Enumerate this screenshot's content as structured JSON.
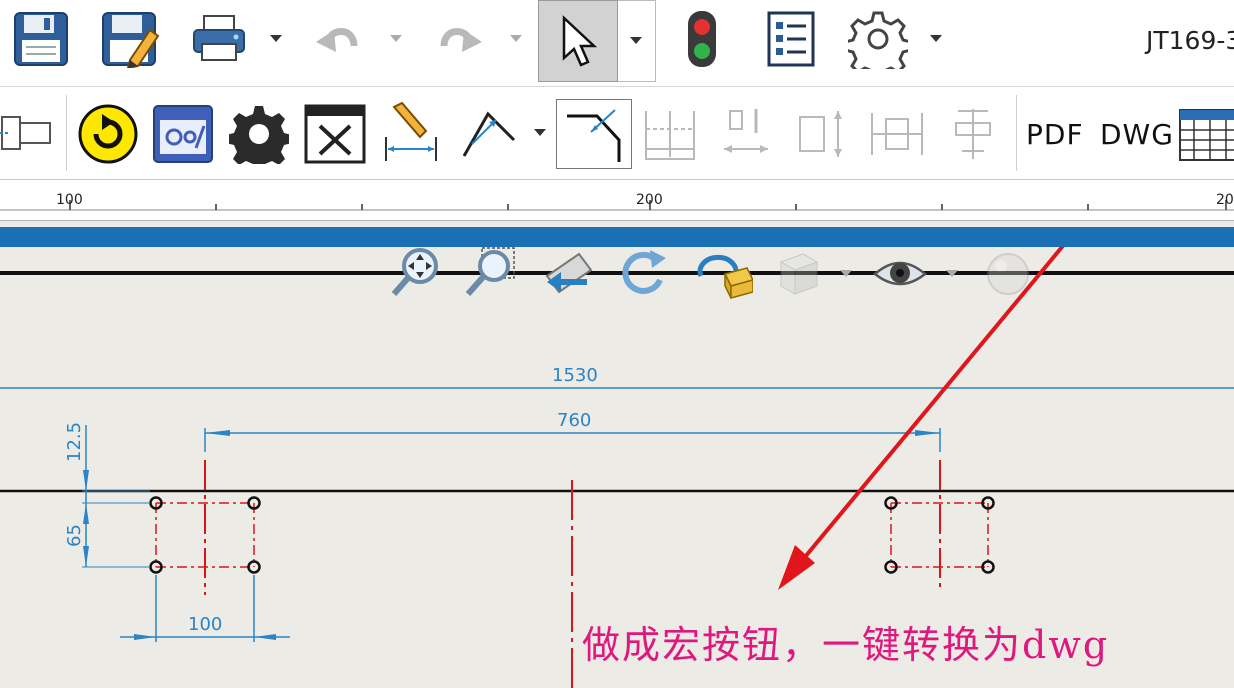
{
  "toolbar": {
    "save_icon": "save-icon",
    "save_as_icon": "save-as-icon",
    "print_icon": "printer-icon",
    "undo_icon": "undo-icon",
    "redo_icon": "redo-icon",
    "select_icon": "cursor-arrow-icon",
    "rebuild_icon": "traffic-light-icon",
    "options_list_icon": "file-properties-icon",
    "settings_icon": "gear-icon"
  },
  "document": {
    "title": "JT169-3"
  },
  "command_bar": {
    "pdf_label": "PDF",
    "dwg_label": "DWG"
  },
  "ruler": {
    "labels": [
      "100",
      "200",
      "20"
    ]
  },
  "drawing": {
    "dim_overall": "1530",
    "dim_span": "760",
    "dim_vertical_top": "12.5",
    "dim_vertical_mid": "65",
    "dim_bottom": "100"
  },
  "annotation": {
    "text": "做成宏按钮，一键转换为dwg"
  },
  "colors": {
    "blue_band": "#1a6fb5",
    "dimension": "#2a84c6",
    "arrow": "#e0161a",
    "annotation": "#e0177e"
  }
}
